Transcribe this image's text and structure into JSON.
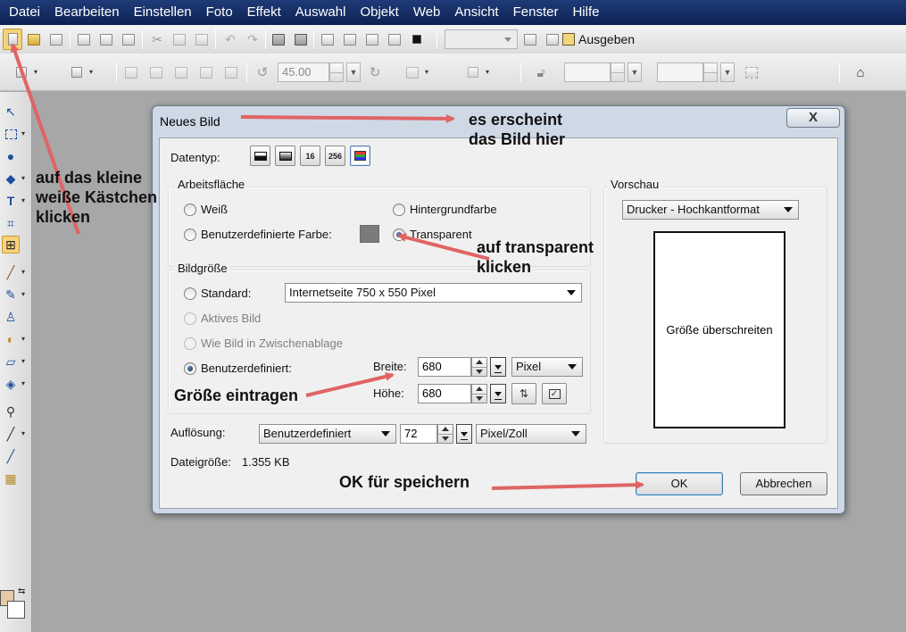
{
  "menu": [
    "Datei",
    "Bearbeiten",
    "Einstellen",
    "Foto",
    "Effekt",
    "Auswahl",
    "Objekt",
    "Web",
    "Ansicht",
    "Fenster",
    "Hilfe"
  ],
  "toolbar": {
    "ausgeben_label": "Ausgeben",
    "rotation_value": "45.00",
    "icons": [
      "new-image-icon",
      "open-icon",
      "save-icon",
      "print-icon",
      "scan-icon",
      "cut-icon",
      "copy-icon",
      "paste-icon",
      "undo-icon",
      "redo-icon",
      "camera-icon"
    ]
  },
  "dialog": {
    "title": "Neues Bild",
    "close_label": "X",
    "datentyp_label": "Datentyp:",
    "datentyp_buttons": [
      "",
      "",
      "16",
      "256",
      ""
    ],
    "arbeitsflaeche": {
      "title": "Arbeitsfläche",
      "weiss": "Weiß",
      "hintergrundfarbe": "Hintergrundfarbe",
      "benutzerdefinierte_farbe": "Benutzerdefinierte Farbe:",
      "transparent": "Transparent",
      "selected": "Transparent",
      "custom_color": "#7b7b7b"
    },
    "bildgroesse": {
      "title": "Bildgröße",
      "standard_label": "Standard:",
      "standard_value": "Internetseite 750 x 550 Pixel",
      "aktives_bild": "Aktives Bild",
      "wie_bild": "Wie Bild in Zwischenablage",
      "benutzerdefiniert": "Benutzerdefiniert:",
      "selected": "Benutzerdefiniert",
      "breite_label": "Breite:",
      "breite_value": "680",
      "hoehe_label": "Höhe:",
      "hoehe_value": "680",
      "unit_value": "Pixel"
    },
    "aufloesung": {
      "label": "Auflösung:",
      "mode_value": "Benutzerdefiniert",
      "value": "72",
      "unit_value": "Pixel/Zoll"
    },
    "dateigroesse": {
      "label": "Dateigröße:",
      "value": "1.355 KB"
    },
    "vorschau": {
      "title": "Vorschau",
      "format_value": "Drucker - Hochkantformat",
      "preview_text": "Größe überschreiten"
    },
    "ok_label": "OK",
    "cancel_label": "Abbrechen"
  },
  "annotations": {
    "click_white_box": [
      "auf das kleine",
      "weiße Kästchen",
      "klicken"
    ],
    "image_appears": [
      "es erscheint",
      "das Bild hier"
    ],
    "click_transparent": [
      "auf transparent",
      "klicken"
    ],
    "enter_size": "Größe eintragen",
    "ok_save": "OK für speichern",
    "arrow_color": "#e06464"
  }
}
